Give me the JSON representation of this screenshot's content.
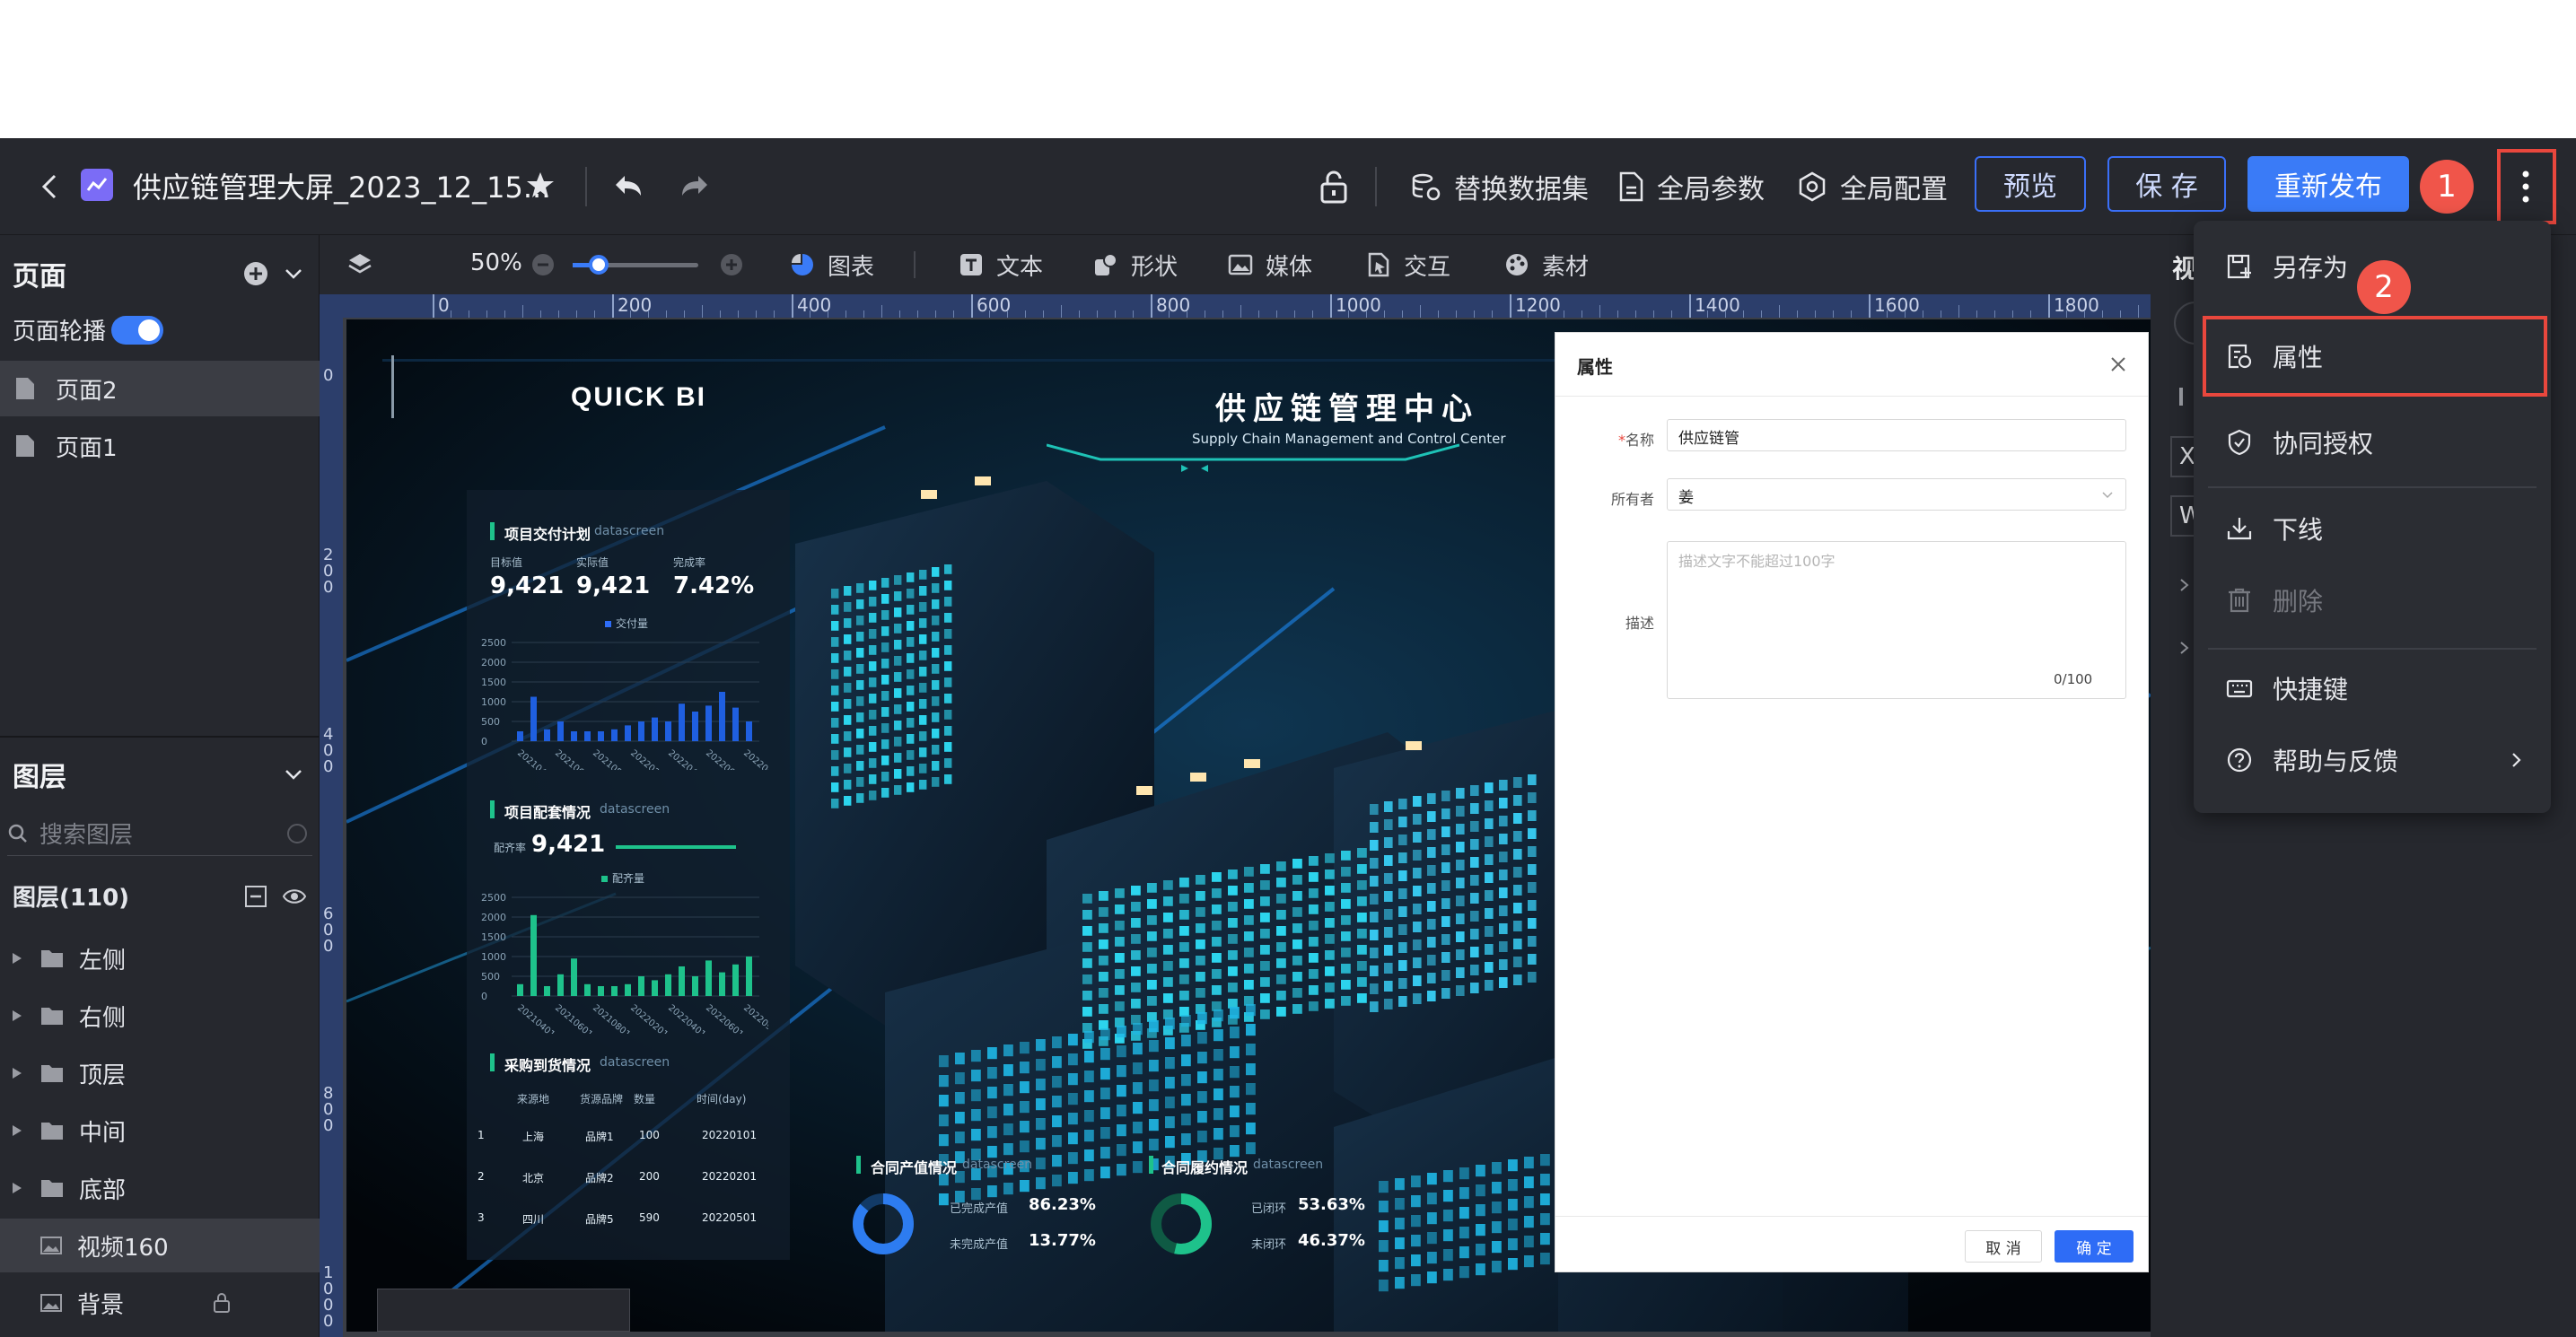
{
  "header": {
    "title": "供应链管理大屏_2023_12_15...",
    "replace_dataset": "替换数据集",
    "global_params": "全局参数",
    "global_config": "全局配置",
    "preview": "预览",
    "save": "保 存",
    "republish": "重新发布"
  },
  "badges": {
    "one": "1",
    "two": "2"
  },
  "toolbar": {
    "zoom": "50%",
    "chart": "图表",
    "text": "文本",
    "shape": "形状",
    "media": "媒体",
    "interaction": "交互",
    "material": "素材"
  },
  "ruler": {
    "top": [
      "0",
      "200",
      "400",
      "600",
      "800",
      "1000",
      "1200",
      "1400",
      "1600",
      "1800"
    ],
    "left": [
      "0",
      "200",
      "400",
      "600",
      "800",
      "1000"
    ]
  },
  "pages": {
    "title": "页面",
    "carousel_label": "页面轮播",
    "items": [
      "页面2",
      "页面1"
    ]
  },
  "layers": {
    "title": "图层",
    "search_placeholder": "搜索图层",
    "count_label": "图层(110)",
    "items": [
      "左侧",
      "右侧",
      "顶层",
      "中间",
      "底部",
      "视频160",
      "背景"
    ]
  },
  "design": {
    "logo": "QUICK BI",
    "main_title": "供应链管理中心",
    "sub_title": "Supply Chain Management and Control Center",
    "panel1": {
      "title": "项目交付计划",
      "tag": "datascreen",
      "labels": [
        "目标值",
        "实际值",
        "完成率"
      ],
      "values": [
        "9,421",
        "9,421",
        "7.42%"
      ],
      "legend": "交付量",
      "y_ticks": [
        "2500",
        "2000",
        "1500",
        "1000",
        "500",
        "0"
      ],
      "x_ticks": [
        "202104",
        "202106",
        "202108",
        "202202",
        "202204",
        "202206",
        "202209"
      ]
    },
    "panel2": {
      "title": "项目配套情况",
      "tag": "datascreen",
      "label": "配齐率",
      "value": "9,421",
      "legend": "配齐量",
      "y_ticks": [
        "2500",
        "2000",
        "1500",
        "1000",
        "500",
        "0"
      ],
      "x_ticks": [
        "20210401",
        "20210601",
        "20210801",
        "20220201",
        "20220401",
        "20220601",
        "20220901"
      ]
    },
    "panel3": {
      "title": "采购到货情况",
      "tag": "datascreen",
      "headers": [
        "来源地",
        "货源品牌",
        "数量",
        "时间(day)"
      ],
      "rows": [
        [
          "1",
          "上海",
          "品牌1",
          "100",
          "20220101"
        ],
        [
          "2",
          "北京",
          "品牌2",
          "200",
          "20220201"
        ],
        [
          "3",
          "四川",
          "品牌5",
          "590",
          "20220501"
        ]
      ]
    },
    "panel4": {
      "title": "合同产值情况",
      "tag": "datascreen",
      "rows": [
        [
          "已完成产值",
          "86.23%"
        ],
        [
          "未完成产值",
          "13.77%"
        ]
      ],
      "donut_fraction": 0.8623
    },
    "panel5": {
      "title": "合同履约情况",
      "tag": "datascreen",
      "rows": [
        [
          "已闭环",
          "53.63%"
        ],
        [
          "未闭环",
          "46.37%"
        ]
      ],
      "donut_fraction": 0.5363
    }
  },
  "modal": {
    "title": "属性",
    "name_label": "名称",
    "name_value": "供应链管",
    "owner_label": "所有者",
    "owner_value": "姜",
    "desc_label": "描述",
    "desc_placeholder": "描述文字不能超过100字",
    "counter": "0/100",
    "cancel": "取 消",
    "ok": "确 定"
  },
  "menu": {
    "save_as": "另存为",
    "properties": "属性",
    "collab": "协同授权",
    "offline": "下线",
    "delete": "删除",
    "shortcuts": "快捷键",
    "help": "帮助与反馈"
  },
  "right_panel": {
    "title_partial": "视",
    "x_label": "X",
    "w_label": "W"
  },
  "colors": {
    "accent": "#2e6cf6",
    "badge": "#f0554a",
    "highlight": "#e9473d",
    "bar_blue": "#1f5fe0",
    "bar_green": "#1ec28b"
  }
}
